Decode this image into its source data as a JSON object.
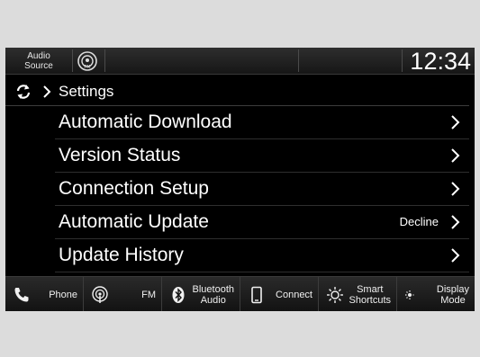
{
  "status_bar": {
    "audio_source_line1": "Audio",
    "audio_source_line2": "Source",
    "clock": "12:34"
  },
  "header": {
    "title": "Settings"
  },
  "settings_items": [
    {
      "label": "Automatic Download",
      "value": ""
    },
    {
      "label": "Version Status",
      "value": ""
    },
    {
      "label": "Connection Setup",
      "value": ""
    },
    {
      "label": "Automatic Update",
      "value": "Decline"
    },
    {
      "label": "Update History",
      "value": ""
    }
  ],
  "bottom_bar": [
    {
      "icon": "phone-icon",
      "line1": "Phone",
      "line2": ""
    },
    {
      "icon": "fm-radio-icon",
      "line1": "FM",
      "line2": ""
    },
    {
      "icon": "bluetooth-icon",
      "line1": "Bluetooth",
      "line2": "Audio"
    },
    {
      "icon": "smartphone-icon",
      "line1": "Connect",
      "line2": ""
    },
    {
      "icon": "smart-shortcuts-icon",
      "line1": "Smart",
      "line2": "Shortcuts"
    },
    {
      "icon": "display-mode-icon",
      "line1": "Display",
      "line2": "Mode"
    }
  ],
  "colors": {
    "screen_bg": "#000000",
    "frame_bg": "#dcdcdc",
    "text": "#ffffff"
  }
}
